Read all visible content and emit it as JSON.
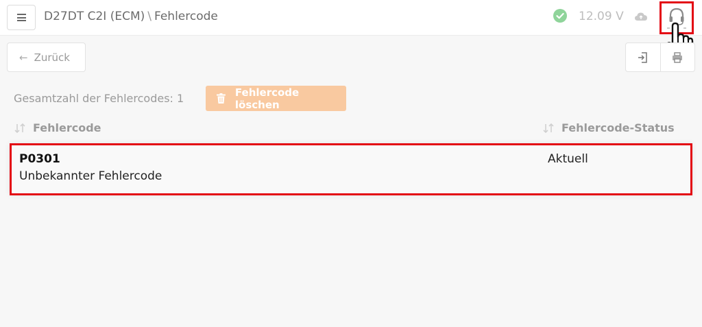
{
  "header": {
    "module": "D27DT C2I (ECM)",
    "separator": "\\",
    "page": "Fehlercode",
    "voltage": "12.09 V"
  },
  "toolbar": {
    "back_label": "Zurück"
  },
  "summary": {
    "total_label": "Gesamtzahl der Fehlercodes: 1",
    "delete_label": "Fehlercode löschen"
  },
  "table": {
    "columns": [
      "Fehlercode",
      "Fehlercode-Status"
    ],
    "rows": [
      {
        "code": "P0301",
        "description": "Unbekannter Fehlercode",
        "status": "Aktuell"
      }
    ]
  },
  "colors": {
    "highlight": "#e30613",
    "delete_button": "#f9c9a0",
    "status_ok": "#8fd49a"
  }
}
